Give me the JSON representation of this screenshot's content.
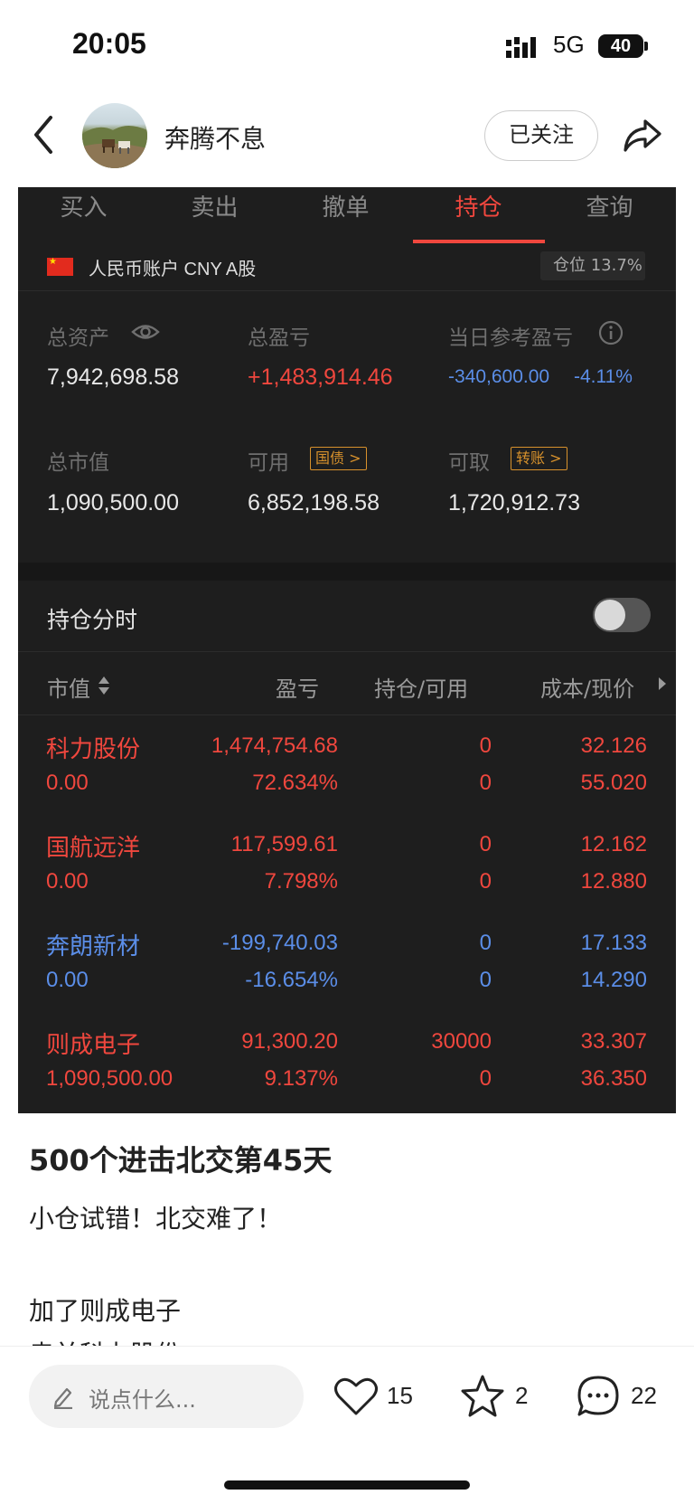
{
  "status_bar": {
    "time": "20:05",
    "network": "5G",
    "battery": "40"
  },
  "header": {
    "username": "奔腾不息",
    "follow_label": "已关注"
  },
  "trade_panel": {
    "tabs": [
      {
        "label": "买入"
      },
      {
        "label": "卖出"
      },
      {
        "label": "撤单"
      },
      {
        "label": "持仓"
      },
      {
        "label": "查询"
      }
    ],
    "active_tab": "持仓",
    "account": {
      "label": "人民币账户 CNY A股",
      "position_ratio": "仓位 13.7%"
    },
    "summary": {
      "total_assets_label": "总资产",
      "total_assets": "7,942,698.58",
      "total_pnl_label": "总盈亏",
      "total_pnl": "+1,483,914.46",
      "daily_pnl_label": "当日参考盈亏",
      "daily_pnl": "-340,600.00",
      "daily_pnl_pct": "-4.11%",
      "market_value_label": "总市值",
      "market_value": "1,090,500.00",
      "available_label": "可用",
      "available_tag": "国债 >",
      "available": "6,852,198.58",
      "withdrawable_label": "可取",
      "withdrawable_tag": "转账 >",
      "withdrawable": "1,720,912.73"
    },
    "timeshare_label": "持仓分时",
    "columns": {
      "market_value": "市值",
      "pnl": "盈亏",
      "holding": "持仓/可用",
      "cost_price": "成本/现价"
    },
    "holdings": [
      {
        "name": "科力股份",
        "market_value": "0.00",
        "pnl": "1,474,754.68",
        "pnl_pct": "72.634%",
        "holding": "0",
        "available": "0",
        "cost": "32.126",
        "price": "55.020",
        "color": "#f0473e"
      },
      {
        "name": "国航远洋",
        "market_value": "0.00",
        "pnl": "117,599.61",
        "pnl_pct": "7.798%",
        "holding": "0",
        "available": "0",
        "cost": "12.162",
        "price": "12.880",
        "color": "#f0473e"
      },
      {
        "name": "奔朗新材",
        "market_value": "0.00",
        "pnl": "-199,740.03",
        "pnl_pct": "-16.654%",
        "holding": "0",
        "available": "0",
        "cost": "17.133",
        "price": "14.290",
        "color": "#5b8ee8"
      },
      {
        "name": "则成电子",
        "market_value": "1,090,500.00",
        "pnl": "91,300.20",
        "pnl_pct": "9.137%",
        "holding": "30000",
        "available": "0",
        "cost": "33.307",
        "price": "36.350",
        "color": "#f0473e"
      }
    ]
  },
  "post": {
    "title": "500个进击北交第45天",
    "lines": [
      "小仓试错！北交难了！",
      "加了则成电子",
      "卖并科力股份"
    ]
  },
  "bottom_bar": {
    "comment_placeholder": "说点什么...",
    "likes": "15",
    "favorites": "2",
    "comments": "22"
  }
}
